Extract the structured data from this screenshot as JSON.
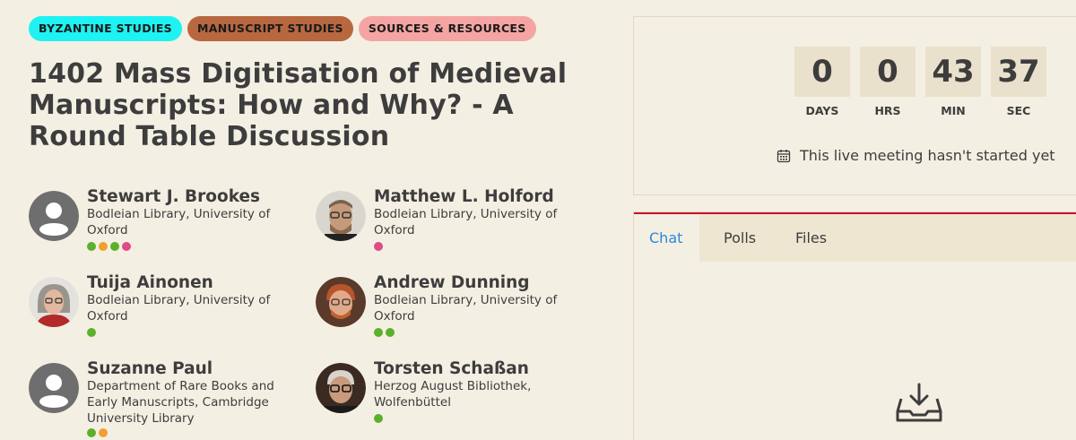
{
  "tags": [
    {
      "label": "BYZANTINE STUDIES",
      "color": "#1ef2f2"
    },
    {
      "label": "MANUSCRIPT STUDIES",
      "color": "#b86840"
    },
    {
      "label": "SOURCES & RESOURCES",
      "color": "#f4a5a3"
    }
  ],
  "title": "1402 Mass Digitisation of Medieval Manuscripts: How and Why? - A Round Table Discussion",
  "speakers": [
    {
      "name": "Stewart J. Brookes",
      "org": "Bodleian Library, University of Oxford",
      "avatar": "placeholder",
      "dots": [
        "#5bb02c",
        "#f0a030",
        "#5bb02c",
        "#e04a85"
      ]
    },
    {
      "name": "Matthew L. Holford",
      "org": "Bodleian Library, University of Oxford",
      "avatar": "photo",
      "dots": [
        "#e04a85"
      ]
    },
    {
      "name": "Tuija Ainonen",
      "org": "Bodleian Library, University of Oxford",
      "avatar": "photo",
      "dots": [
        "#5bb02c"
      ]
    },
    {
      "name": "Andrew Dunning",
      "org": "Bodleian Library, University of Oxford",
      "avatar": "photo",
      "dots": [
        "#5bb02c",
        "#5bb02c"
      ]
    },
    {
      "name": "Suzanne Paul",
      "org": "Department of Rare Books and Early Manuscripts, Cambridge University Library",
      "avatar": "placeholder",
      "dots": [
        "#5bb02c",
        "#f0a030"
      ]
    },
    {
      "name": "Torsten Schaßan",
      "org": "Herzog August Bibliothek, Wolfenbüttel",
      "avatar": "photo",
      "dots": [
        "#5bb02c"
      ]
    }
  ],
  "countdown": {
    "days": "0",
    "days_label": "DAYS",
    "hrs": "0",
    "hrs_label": "HRS",
    "min": "43",
    "min_label": "MIN",
    "sec": "37",
    "sec_label": "SEC"
  },
  "status_text": "This live meeting hasn't started yet",
  "status_icon": "calendar-icon",
  "tabs": [
    {
      "label": "Chat",
      "active": true
    },
    {
      "label": "Polls",
      "active": false
    },
    {
      "label": "Files",
      "active": false
    }
  ],
  "empty_icon": "inbox-download-icon",
  "colors": {
    "accent": "#2d87d6",
    "tab_border": "#c8102e",
    "background": "#f4efe3"
  }
}
